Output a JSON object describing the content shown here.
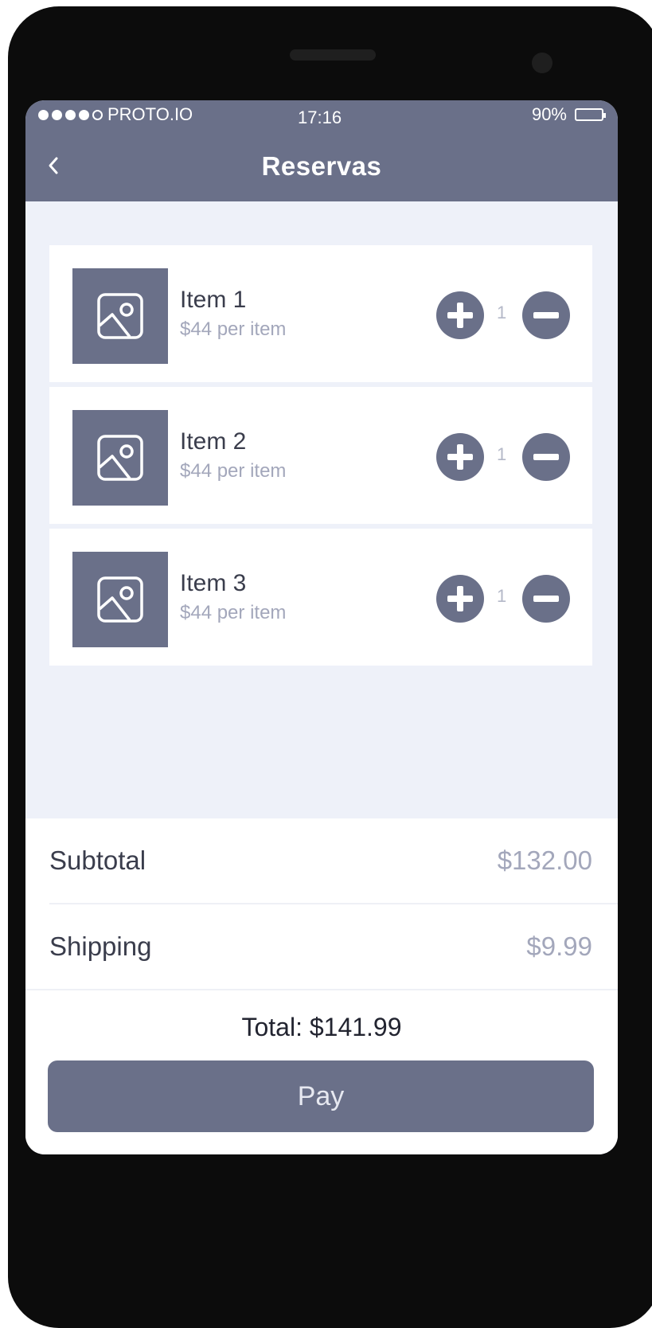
{
  "status_bar": {
    "carrier": "PROTO.IO",
    "time": "17:16",
    "battery": "90%",
    "battery_level": 0.9
  },
  "header": {
    "back_glyph": "‹",
    "title": "Reservas"
  },
  "items": [
    {
      "name": "Item 1",
      "price": "$44 per item",
      "quantity": "1"
    },
    {
      "name": "Item 2",
      "price": "$44 per item",
      "quantity": "1"
    },
    {
      "name": "Item 3",
      "price": "$44 per item",
      "quantity": "1"
    }
  ],
  "summary": {
    "subtotal_label": "Subtotal",
    "subtotal_value": "$132.00",
    "shipping_label": "Shipping",
    "shipping_value": "$9.99",
    "total": "Total: $141.99",
    "pay_label": "Pay"
  },
  "icons": {
    "back": "chevron-left-icon",
    "thumbnail": "image-placeholder-icon",
    "increase": "plus-circle-icon",
    "decrease": "minus-circle-icon",
    "battery": "battery-icon"
  },
  "colors": {
    "primary": "#6a7089",
    "background": "#eef1f9",
    "muted_text": "#a3a7bb"
  }
}
